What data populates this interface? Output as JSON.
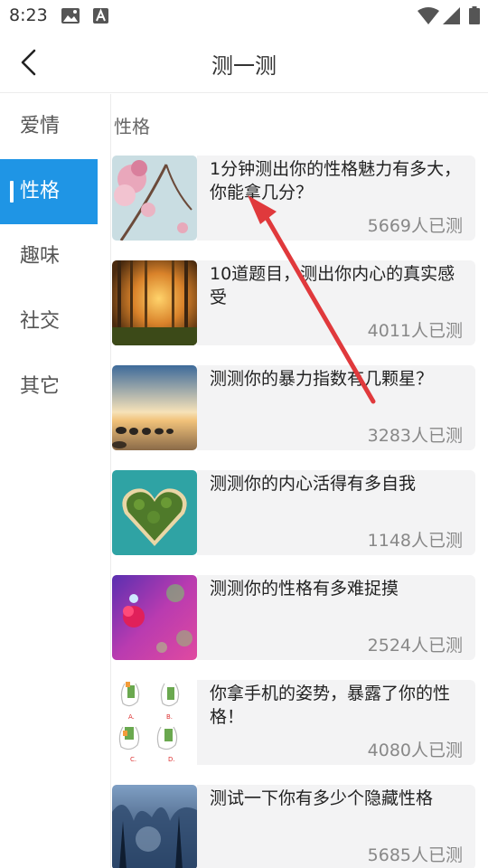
{
  "status_bar": {
    "time": "8:23",
    "icons": [
      "photo-icon",
      "text-a-icon",
      "wifi-icon",
      "signal-icon",
      "battery-icon"
    ]
  },
  "header": {
    "back_icon": "chevron-left-icon",
    "title": "测一测"
  },
  "sidebar": {
    "items": [
      {
        "label": "爱情",
        "active": false
      },
      {
        "label": "性格",
        "active": true
      },
      {
        "label": "趣味",
        "active": false
      },
      {
        "label": "社交",
        "active": false
      },
      {
        "label": "其它",
        "active": false
      }
    ]
  },
  "main": {
    "section_title": "性格",
    "cards": [
      {
        "title": "1分钟测出你的性格魅力有多大，你能拿几分？",
        "count": "5669人已测",
        "thumb": "cherry-blossom"
      },
      {
        "title": "10道题目，测出你内心的真实感受",
        "count": "4011人已测",
        "thumb": "sunlit-forest"
      },
      {
        "title": "测测你的暴力指数有几颗星？",
        "count": "3283人已测",
        "thumb": "sunset-sea"
      },
      {
        "title": "测测你的内心活得有多自我",
        "count": "1148人已测",
        "thumb": "heart-island"
      },
      {
        "title": "测测你的性格有多难捉摸",
        "count": "2524人已测",
        "thumb": "pink-flower-bokeh"
      },
      {
        "title": "你拿手机的姿势，暴露了你的性格！",
        "count": "4080人已测",
        "thumb": "phone-hand-poses",
        "thumb_labels": [
          "A.",
          "B.",
          "C.",
          "D."
        ]
      },
      {
        "title": "测试一下你有多少个隐藏性格",
        "count": "5685人已测",
        "thumb": "blue-frost-forest"
      }
    ]
  },
  "colors": {
    "accent": "#1f95e5",
    "arrow": "#e0393c",
    "card_bg": "#f3f3f4"
  }
}
